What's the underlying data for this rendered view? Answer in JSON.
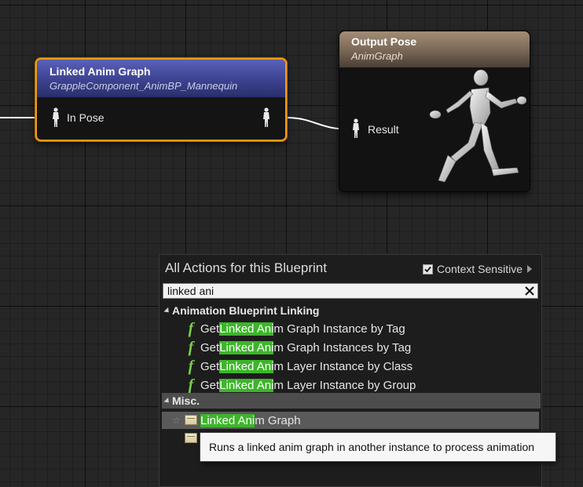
{
  "linked_node": {
    "title": "Linked Anim Graph",
    "subtitle": "GrappleComponent_AnimBP_Mannequin",
    "input_pin": "In Pose",
    "header_color": "#3c4290",
    "selection_color": "#f39c12"
  },
  "output_node": {
    "title": "Output Pose",
    "subtitle": "AnimGraph",
    "input_pin": "Result",
    "header_color": "#7c6a58"
  },
  "action_menu": {
    "title": "All Actions for this Blueprint",
    "context_sensitive_label": "Context Sensitive",
    "context_sensitive_checked": true,
    "search_value": "linked ani",
    "highlight_color": "#3db52a",
    "categories": [
      {
        "label": "Animation Blueprint Linking",
        "items": [
          {
            "prefix": "Get ",
            "match": "Linked Ani",
            "suffix": "m Graph Instance by Tag",
            "icon": "function-icon"
          },
          {
            "prefix": "Get ",
            "match": "Linked Ani",
            "suffix": "m Graph Instances by Tag",
            "icon": "function-icon"
          },
          {
            "prefix": "Get ",
            "match": "Linked Ani",
            "suffix": "m Layer Instance by Class",
            "icon": "function-icon"
          },
          {
            "prefix": "Get ",
            "match": "Linked Ani",
            "suffix": "m Layer Instance by Group",
            "icon": "function-icon"
          }
        ]
      },
      {
        "label": "Misc.",
        "items": [
          {
            "prefix": "",
            "match": "Linked Ani",
            "suffix": "m Graph",
            "icon": "anim-node-icon",
            "selected": true
          }
        ]
      }
    ]
  },
  "tooltip": {
    "text": "Runs a linked anim graph in another instance to process animation"
  }
}
